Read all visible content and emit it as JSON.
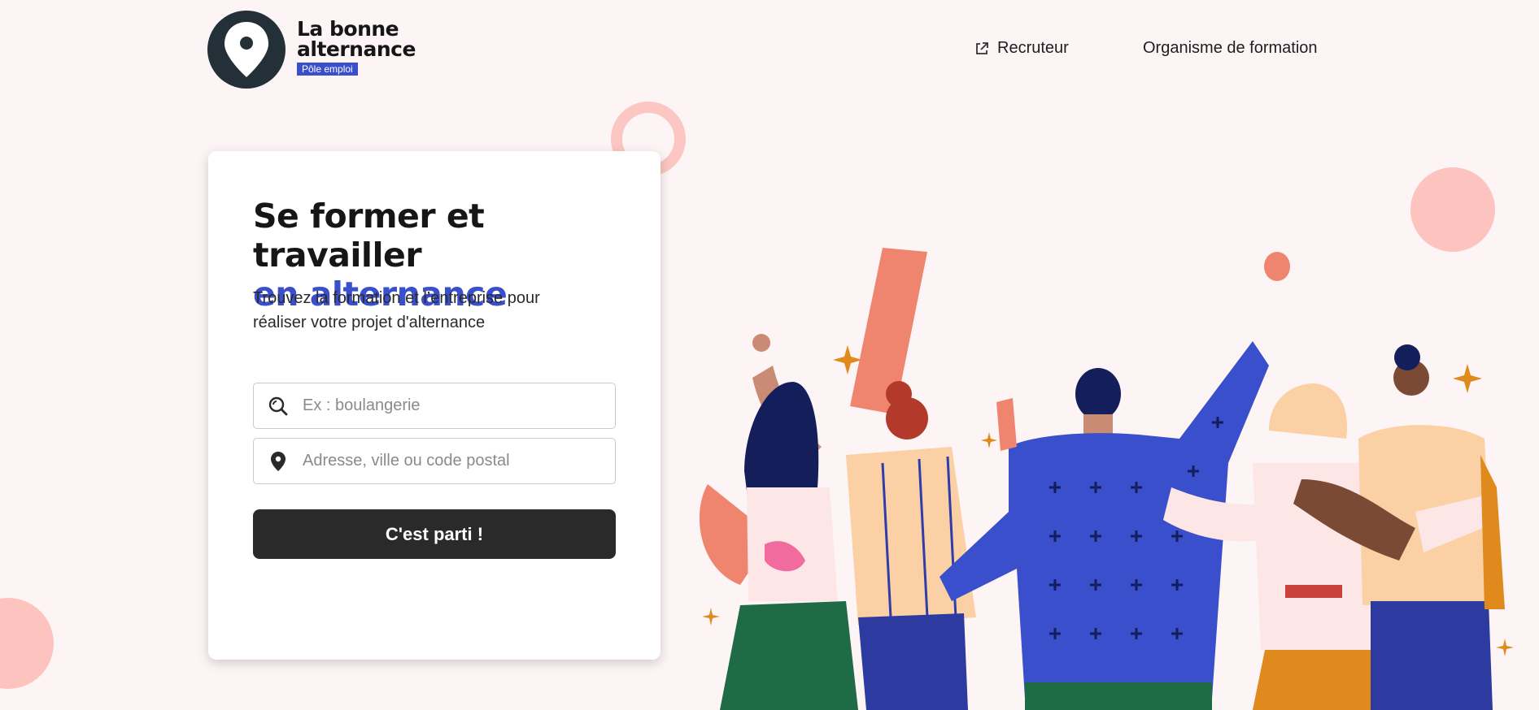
{
  "header": {
    "logo": {
      "line1": "La bonne",
      "line2": "alternance",
      "badge": "Pôle emploi"
    },
    "nav": {
      "recruteur": "Recruteur",
      "organisme": "Organisme de formation"
    }
  },
  "hero": {
    "title_line1": "Se former et travailler",
    "title_line2": "en alternance",
    "subtitle": "Trouvez la formation et l’entreprise pour réaliser votre projet d'alternance"
  },
  "search": {
    "job_placeholder": "Ex : boulangerie",
    "location_placeholder": "Adresse, ville ou code postal",
    "submit_label": "C'est parti !"
  },
  "colors": {
    "accent": "#3a4fcc",
    "background": "#fdf5f5",
    "button": "#2a2a2a",
    "decor_pink": "#fdc3be"
  }
}
